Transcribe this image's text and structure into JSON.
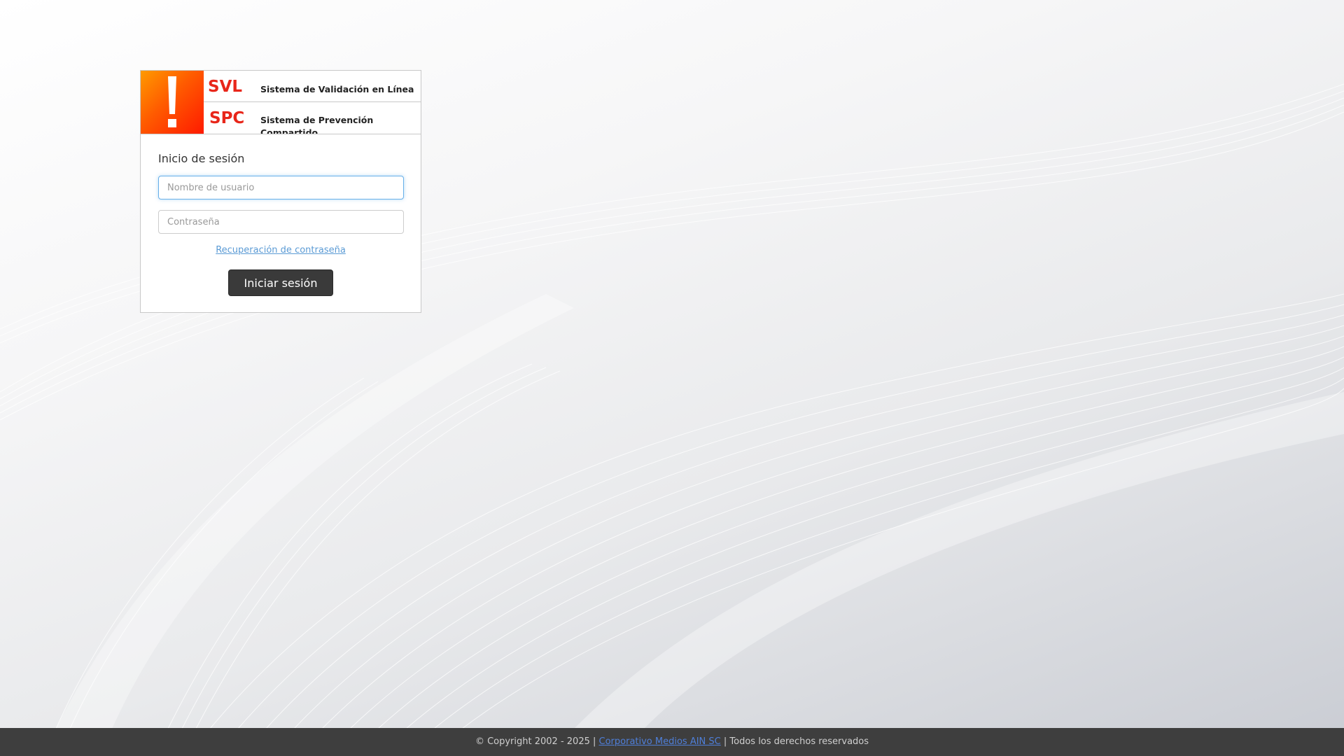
{
  "header": {
    "svl_mark": "SVL",
    "svl_title": "Sistema de Validación en Línea",
    "spc_mark": "SPC",
    "spc_title": "Sistema de Prevención Compartido"
  },
  "login": {
    "title": "Inicio de sesión",
    "username_placeholder": "Nombre de usuario",
    "username_value": "",
    "password_placeholder": "Contraseña",
    "password_value": "",
    "recover_label": "Recuperación de contraseña",
    "submit_label": "Iniciar sesión"
  },
  "footer": {
    "copyright": "© Copyright 2002 - 2025 |",
    "company_link": "Corporativo Medios AIN SC",
    "rights": "| Todos los derechos reservados"
  },
  "colors": {
    "brand_orange": "#ff5a00",
    "brand_red": "#e8261a",
    "button_dark": "#3a3a3a",
    "footer_bg": "#3e3e3e",
    "link_blue": "#5b9bd5"
  },
  "icons": {
    "logo": "exclamation-icon"
  }
}
